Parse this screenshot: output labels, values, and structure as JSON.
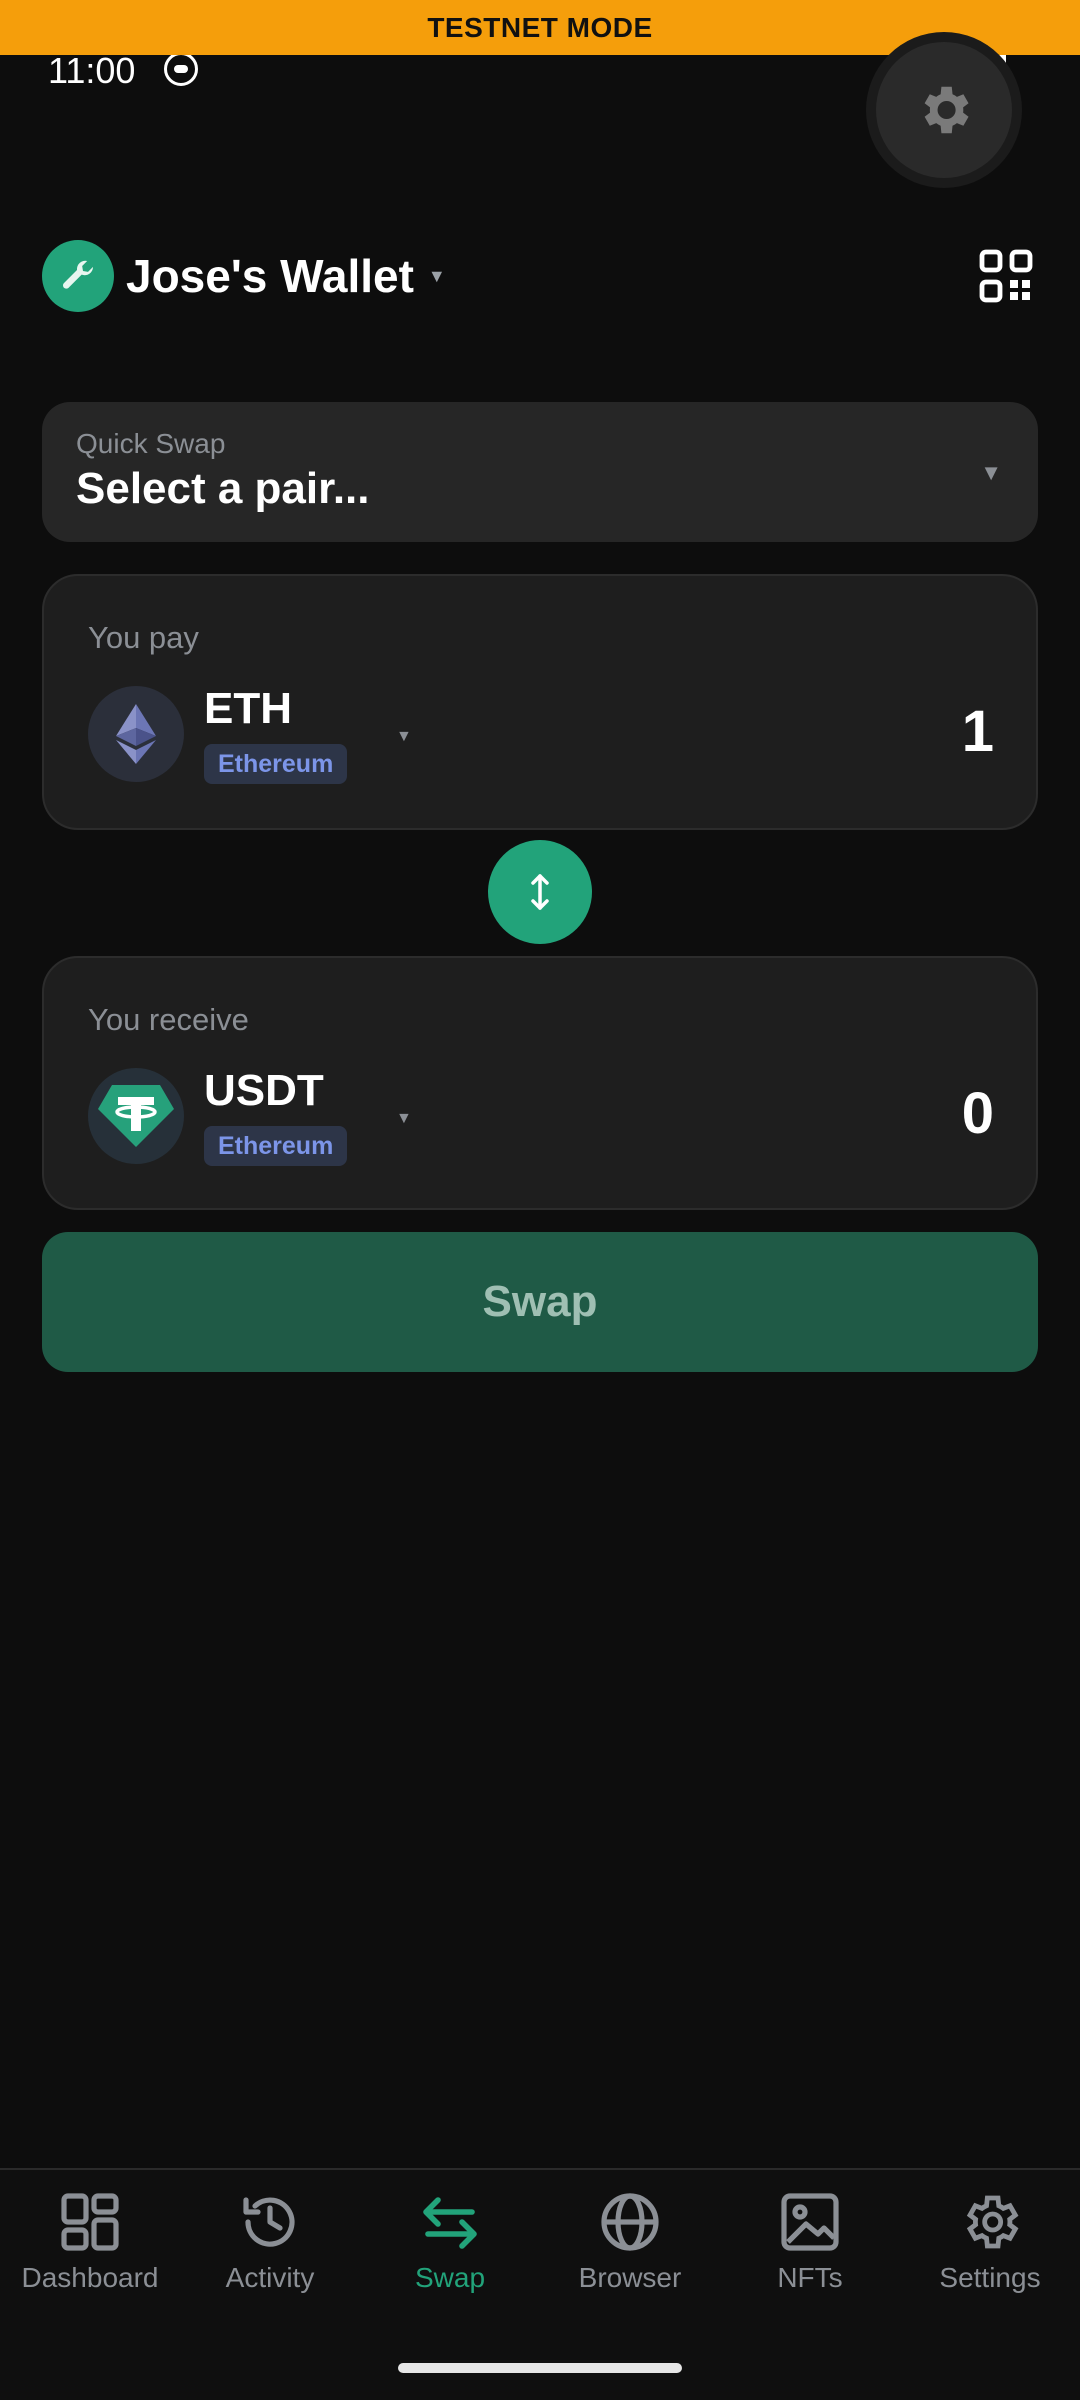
{
  "banner": {
    "text": "TESTNET MODE"
  },
  "status": {
    "time": "11:00"
  },
  "wallet": {
    "name": "Jose's Wallet"
  },
  "quick_swap": {
    "label": "Quick Swap",
    "value": "Select a pair..."
  },
  "pay": {
    "label": "You pay",
    "symbol": "ETH",
    "chain": "Ethereum",
    "amount": "1"
  },
  "receive": {
    "label": "You receive",
    "symbol": "USDT",
    "chain": "Ethereum",
    "amount": "0"
  },
  "swap_button": {
    "label": "Swap"
  },
  "nav": {
    "items": [
      {
        "label": "Dashboard",
        "icon": "dashboard-icon"
      },
      {
        "label": "Activity",
        "icon": "history-icon"
      },
      {
        "label": "Swap",
        "icon": "swap-arrows-icon"
      },
      {
        "label": "Browser",
        "icon": "globe-icon"
      },
      {
        "label": "NFTs",
        "icon": "image-icon"
      },
      {
        "label": "Settings",
        "icon": "gear-icon"
      }
    ],
    "active": "Swap"
  },
  "colors": {
    "accent": "#22a37a",
    "banner": "#f59e0b",
    "background": "#0d0d0d",
    "card": "#1e1e1e",
    "chain_badge_bg": "#2d3548",
    "chain_badge_text": "#7c95e8",
    "swap_button_bg": "#1f5a46"
  }
}
